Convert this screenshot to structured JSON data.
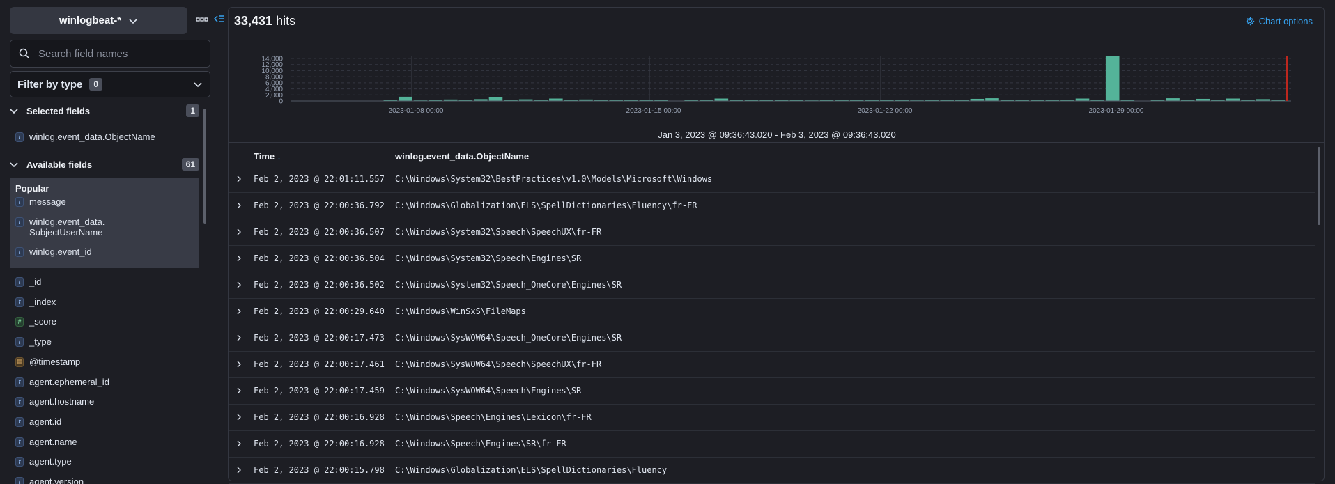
{
  "sidebar": {
    "index_pattern": "winlogbeat-*",
    "search_placeholder": "Search field names",
    "filter_label": "Filter by type",
    "filter_count": "0",
    "selected": {
      "title": "Selected fields",
      "count": "1",
      "fields": [
        {
          "type": "t",
          "name": "winlog.event_data.ObjectName"
        }
      ]
    },
    "available": {
      "title": "Available fields",
      "count": "61"
    },
    "popular": {
      "title": "Popular",
      "fields": [
        {
          "type": "t",
          "name": "message"
        },
        {
          "type": "t",
          "name": "winlog.event_data.\nSubjectUserName"
        },
        {
          "type": "t",
          "name": "winlog.event_id"
        }
      ]
    },
    "fields": [
      {
        "type": "t",
        "name": "_id"
      },
      {
        "type": "t",
        "name": "_index"
      },
      {
        "type": "#",
        "name": "_score"
      },
      {
        "type": "t",
        "name": "_type"
      },
      {
        "type": "d",
        "name": "@timestamp"
      },
      {
        "type": "t",
        "name": "agent.ephemeral_id"
      },
      {
        "type": "t",
        "name": "agent.hostname"
      },
      {
        "type": "t",
        "name": "agent.id"
      },
      {
        "type": "t",
        "name": "agent.name"
      },
      {
        "type": "t",
        "name": "agent.type"
      },
      {
        "type": "t",
        "name": "agent.version"
      }
    ]
  },
  "main": {
    "hits_count": "33,431",
    "hits_label": "hits",
    "chart_options": "Chart options",
    "time_range": "Jan 3, 2023 @ 09:36:43.020 - Feb 3, 2023 @ 09:36:43.020",
    "table": {
      "col_time": "Time",
      "col_object": "winlog.event_data.ObjectName",
      "rows": [
        {
          "time": "Feb 2, 2023 @ 22:01:11.557",
          "object": "C:\\Windows\\System32\\BestPractices\\v1.0\\Models\\Microsoft\\Windows"
        },
        {
          "time": "Feb 2, 2023 @ 22:00:36.792",
          "object": "C:\\Windows\\Globalization\\ELS\\SpellDictionaries\\Fluency\\fr-FR"
        },
        {
          "time": "Feb 2, 2023 @ 22:00:36.507",
          "object": "C:\\Windows\\System32\\Speech\\SpeechUX\\fr-FR"
        },
        {
          "time": "Feb 2, 2023 @ 22:00:36.504",
          "object": "C:\\Windows\\System32\\Speech\\Engines\\SR"
        },
        {
          "time": "Feb 2, 2023 @ 22:00:36.502",
          "object": "C:\\Windows\\System32\\Speech_OneCore\\Engines\\SR"
        },
        {
          "time": "Feb 2, 2023 @ 22:00:29.640",
          "object": "C:\\Windows\\WinSxS\\FileMaps"
        },
        {
          "time": "Feb 2, 2023 @ 22:00:17.473",
          "object": "C:\\Windows\\SysWOW64\\Speech_OneCore\\Engines\\SR"
        },
        {
          "time": "Feb 2, 2023 @ 22:00:17.461",
          "object": "C:\\Windows\\SysWOW64\\Speech\\SpeechUX\\fr-FR"
        },
        {
          "time": "Feb 2, 2023 @ 22:00:17.459",
          "object": "C:\\Windows\\SysWOW64\\Speech\\Engines\\SR"
        },
        {
          "time": "Feb 2, 2023 @ 22:00:16.928",
          "object": "C:\\Windows\\Speech\\Engines\\Lexicon\\fr-FR"
        },
        {
          "time": "Feb 2, 2023 @ 22:00:16.928",
          "object": "C:\\Windows\\Speech\\Engines\\SR\\fr-FR"
        },
        {
          "time": "Feb 2, 2023 @ 22:00:15.798",
          "object": "C:\\Windows\\Globalization\\ELS\\SpellDictionaries\\Fluency"
        }
      ]
    }
  },
  "colors": {
    "bar": "#54b399",
    "accent": "#36a2ef",
    "now_line": "#bd271e"
  },
  "chart_data": {
    "type": "bar",
    "x_ticks": [
      "2023-01-08 00:00",
      "2023-01-15 00:00",
      "2023-01-22 00:00",
      "2023-01-29 00:00"
    ],
    "y_ticks": [
      "14,000",
      "12,000",
      "10,000",
      "8,000",
      "6,000",
      "4,000",
      "2,000",
      "0"
    ],
    "ylim": [
      0,
      14000
    ],
    "values": [
      0,
      0,
      0,
      0,
      0,
      0,
      300,
      1400,
      200,
      400,
      500,
      350,
      600,
      1200,
      300,
      550,
      400,
      800,
      400,
      500,
      300,
      400,
      350,
      300,
      350,
      0,
      300,
      400,
      800,
      350,
      300,
      400,
      350,
      300,
      200,
      300,
      350,
      300,
      400,
      350,
      300,
      200,
      300,
      400,
      300,
      700,
      900,
      300,
      400,
      450,
      350,
      300,
      800,
      400,
      14800,
      400,
      0,
      300,
      900,
      350,
      700,
      400,
      800,
      350,
      600,
      350
    ],
    "grid": true
  }
}
